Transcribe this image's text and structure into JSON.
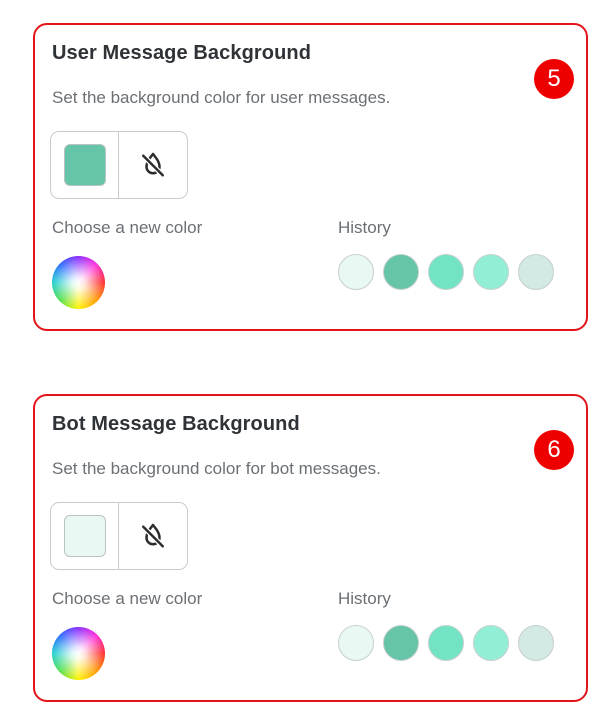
{
  "cards": [
    {
      "title": "User Message Background",
      "description": "Set the background color for user messages.",
      "badge": "5",
      "current_color": "#66c4a8",
      "choose_label": "Choose a new color",
      "history_label": "History",
      "history": [
        "#e9f8f2",
        "#66c4a8",
        "#72e4c3",
        "#92efd6",
        "#d3e9e4"
      ]
    },
    {
      "title": "Bot Message Background",
      "description": "Set the background color for bot messages.",
      "badge": "6",
      "current_color": "#e9f8f2",
      "choose_label": "Choose a new color",
      "history_label": "History",
      "history": [
        "#e9f8f2",
        "#66c4a8",
        "#72e4c3",
        "#92efd6",
        "#d3e9e4"
      ]
    }
  ],
  "icons": {
    "clear_color": "no-color-drop-icon",
    "picker": "color-wheel-icon"
  },
  "colors": {
    "card_border": "#e3151a",
    "badge": "#ee0000"
  }
}
